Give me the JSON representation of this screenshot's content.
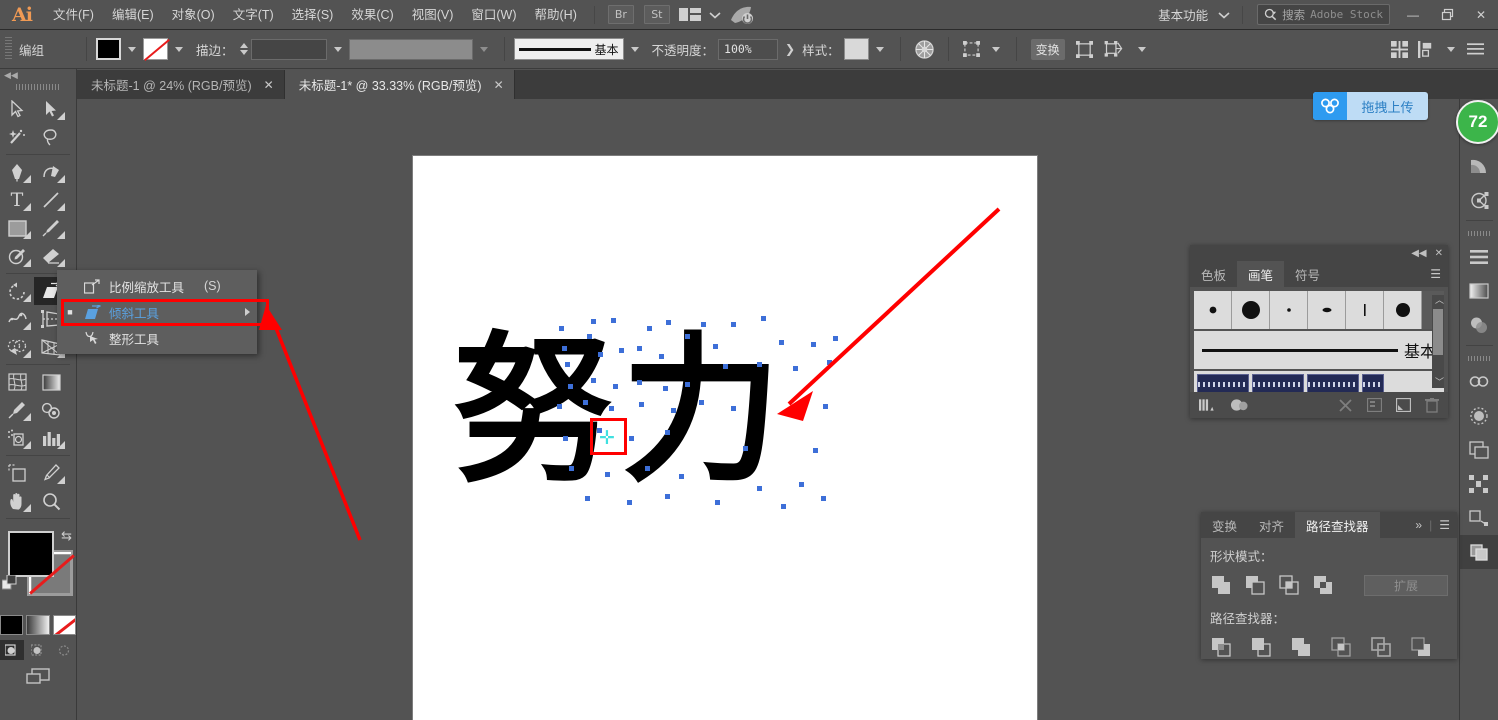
{
  "app": {
    "logo": "Ai",
    "menus": [
      "文件(F)",
      "编辑(E)",
      "对象(O)",
      "文字(T)",
      "选择(S)",
      "效果(C)",
      "视图(V)",
      "窗口(W)",
      "帮助(H)"
    ],
    "bridge_label": "Br",
    "stock_label": "St",
    "workspace": "基本功能",
    "search_label": "搜索",
    "search_placeholder": "Adobe Stock",
    "minimize": "—",
    "restore": "❐",
    "close": "✕"
  },
  "control_bar": {
    "selection_label": "编组",
    "stroke_label": "描边：",
    "stroke_width": "",
    "profile": "",
    "brush_def": "基本",
    "opacity_label": "不透明度：",
    "opacity_value": "100%",
    "style_label": "样式：",
    "transform_label": "变换"
  },
  "tabs": [
    {
      "title": "未标题-1 @ 24% (RGB/预览)",
      "active": false,
      "close": "✕"
    },
    {
      "title": "未标题-1* @ 33.33% (RGB/预览)",
      "active": true,
      "close": "✕"
    }
  ],
  "toolbar": {
    "tools": [
      {
        "name": "selection-tool",
        "row": 0,
        "col": 0,
        "corner": false
      },
      {
        "name": "direct-selection-tool",
        "row": 0,
        "col": 1,
        "corner": true
      },
      {
        "name": "magic-wand-tool",
        "row": 1,
        "col": 0,
        "corner": false
      },
      {
        "name": "lasso-tool",
        "row": 1,
        "col": 1,
        "corner": false
      },
      {
        "name": "pen-tool",
        "row": 2,
        "col": 0,
        "corner": true
      },
      {
        "name": "curvature-tool",
        "row": 2,
        "col": 1,
        "corner": true
      },
      {
        "name": "type-tool",
        "row": 3,
        "col": 0,
        "corner": true
      },
      {
        "name": "line-segment-tool",
        "row": 3,
        "col": 1,
        "corner": true
      },
      {
        "name": "rectangle-tool",
        "row": 4,
        "col": 0,
        "corner": true
      },
      {
        "name": "paintbrush-tool",
        "row": 4,
        "col": 1,
        "corner": true
      },
      {
        "name": "shaper-tool",
        "row": 5,
        "col": 0,
        "corner": true
      },
      {
        "name": "eraser-tool",
        "row": 5,
        "col": 1,
        "corner": true
      },
      {
        "name": "rotate-tool",
        "row": 6,
        "col": 0,
        "corner": true
      },
      {
        "name": "shear-tool",
        "row": 6,
        "col": 1,
        "corner": true,
        "selected": true
      },
      {
        "name": "width-tool",
        "row": 7,
        "col": 0,
        "corner": true
      },
      {
        "name": "free-transform-tool",
        "row": 7,
        "col": 1,
        "corner": true
      },
      {
        "name": "shape-builder-tool",
        "row": 8,
        "col": 0,
        "corner": true
      },
      {
        "name": "perspective-grid-tool",
        "row": 8,
        "col": 1,
        "corner": true
      },
      {
        "name": "mesh-tool",
        "row": 9,
        "col": 0,
        "corner": false
      },
      {
        "name": "gradient-tool",
        "row": 9,
        "col": 1,
        "corner": false
      },
      {
        "name": "eyedropper-tool",
        "row": 10,
        "col": 0,
        "corner": true
      },
      {
        "name": "blend-tool",
        "row": 10,
        "col": 1,
        "corner": false
      },
      {
        "name": "symbol-sprayer-tool",
        "row": 11,
        "col": 0,
        "corner": true
      },
      {
        "name": "column-graph-tool",
        "row": 11,
        "col": 1,
        "corner": true
      },
      {
        "name": "artboard-tool",
        "row": 12,
        "col": 0,
        "corner": false
      },
      {
        "name": "slice-tool",
        "row": 12,
        "col": 1,
        "corner": true
      },
      {
        "name": "hand-tool",
        "row": 13,
        "col": 0,
        "corner": true
      },
      {
        "name": "zoom-tool",
        "row": 13,
        "col": 1,
        "corner": false
      }
    ],
    "fill_color": "#000000",
    "stroke_color": "none"
  },
  "flyout_menu": {
    "items": [
      {
        "label": "比例缩放工具",
        "shortcut": "(S)",
        "icon": "scale-tool-icon",
        "highlighted": false,
        "submarker": false
      },
      {
        "label": "倾斜工具",
        "shortcut": "",
        "icon": "shear-tool-icon",
        "highlighted": true,
        "submarker": true
      },
      {
        "label": "整形工具",
        "shortcut": "",
        "icon": "reshape-tool-icon",
        "highlighted": false,
        "submarker": false
      }
    ]
  },
  "canvas": {
    "artwork_text": "努力",
    "reference_point_icon": "reference-point-crosshair",
    "zoom": "33.33%"
  },
  "upload": {
    "label": "拖拽上传",
    "icon": "baidu-cloud-icon"
  },
  "right_dock": {
    "badge": "72",
    "items": [
      {
        "name": "properties-icon"
      },
      {
        "name": "color-guide-icon"
      },
      {
        "name": "path-edit-icon"
      },
      {
        "name": "libraries-icon"
      },
      {
        "name": "layers-icon"
      },
      {
        "name": "gradient-icon"
      },
      {
        "name": "transparency-icon"
      },
      {
        "name": "creative-cloud-icon"
      },
      {
        "name": "appearance-icon"
      },
      {
        "name": "artboards-icon"
      },
      {
        "name": "align-panel-icon"
      },
      {
        "name": "pathfinder-panel-icon"
      }
    ]
  },
  "brushes_panel": {
    "tabs": [
      {
        "label": "色板",
        "active": false
      },
      {
        "label": "画笔",
        "active": true
      },
      {
        "label": "符号",
        "active": false
      }
    ],
    "collapse_icon": "◀◀",
    "close_icon": "✕",
    "menu_icon": "☰",
    "basic_label": "基本",
    "footer": {
      "libraries": "brush-libraries-icon",
      "library_mgr": "library-menu-icon",
      "remove_stroke": "remove-brush-stroke-icon",
      "options": "brush-options-icon",
      "new_brush": "new-brush-icon",
      "delete": "delete-brush-icon"
    }
  },
  "pathfinder_panel": {
    "tabs": [
      {
        "label": "变换",
        "active": false
      },
      {
        "label": "对齐",
        "active": false
      },
      {
        "label": "路径查找器",
        "active": true
      }
    ],
    "overflow_icon": "»",
    "menu_icon": "☰",
    "shape_modes_label": "形状模式：",
    "expand_label": "扩展",
    "pathfinders_label": "路径查找器：",
    "shape_mode_buttons": [
      "unite-icon",
      "minus-front-icon",
      "intersect-icon",
      "exclude-icon"
    ],
    "pathfinder_buttons": [
      "divide-icon",
      "trim-icon",
      "merge-icon",
      "crop-icon",
      "outline-icon",
      "minus-back-icon"
    ]
  },
  "colors": {
    "accent_red": "#ff0000",
    "selection_blue": "#3d6fd8",
    "reference_cyan": "#3fe0e0",
    "upload_blue": "#2e9bf0",
    "badge_green": "#3cb54a",
    "panel_bg": "#535353",
    "highlight_text": "#5aa1e0"
  }
}
